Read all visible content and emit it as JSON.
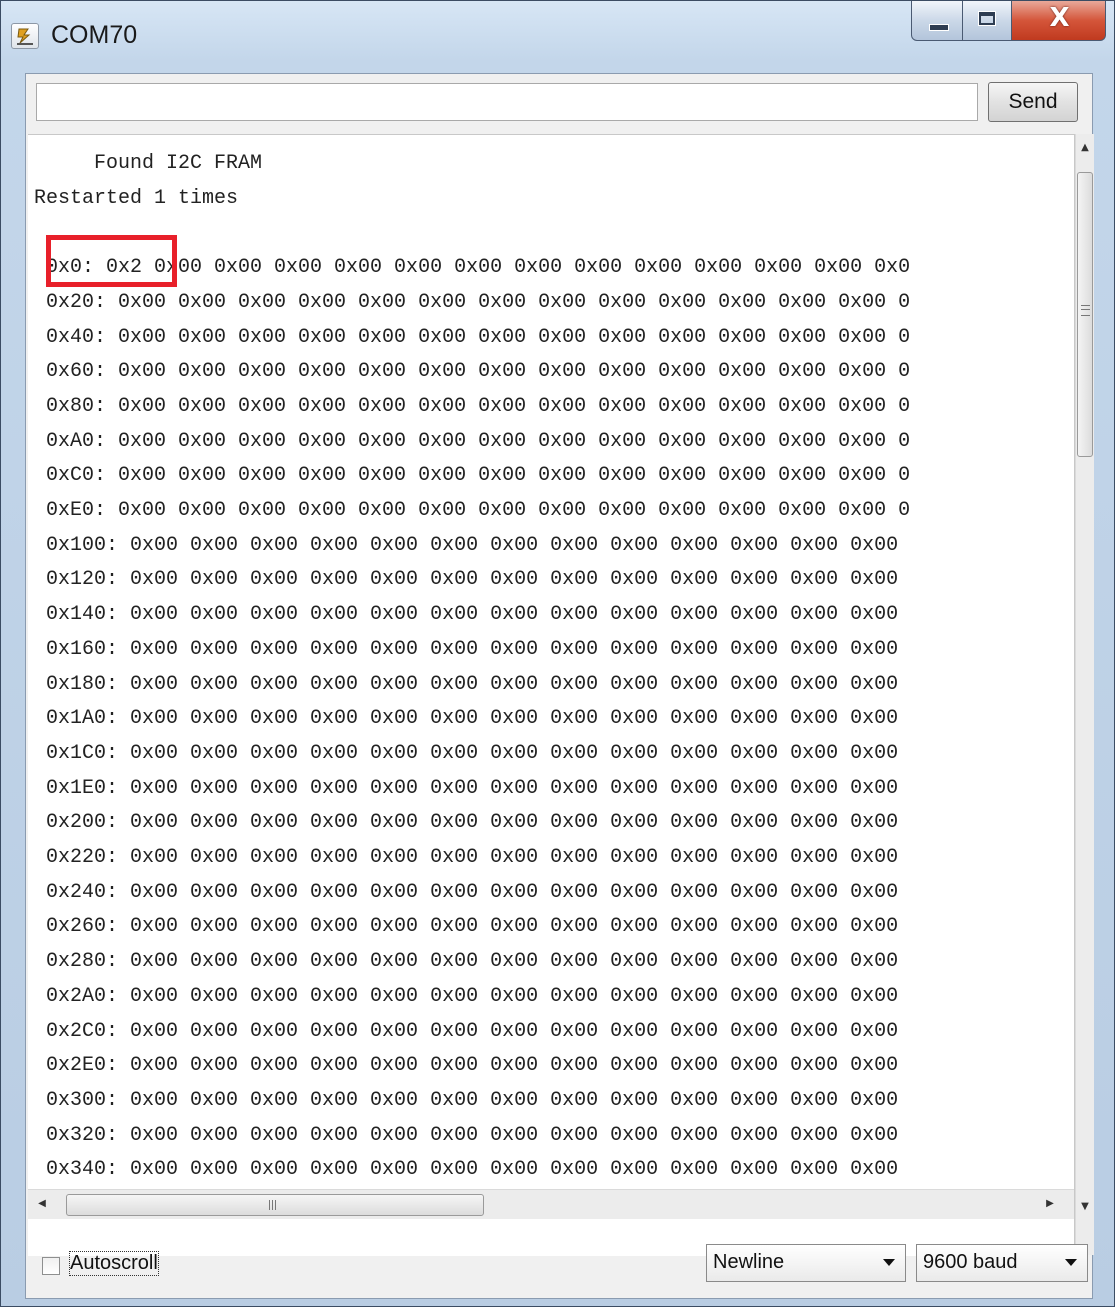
{
  "window": {
    "title": "COM70",
    "app_icon": "serial-monitor-icon",
    "controls": [
      "minimize",
      "maximize",
      "close"
    ],
    "close_glyph": "X"
  },
  "input": {
    "value": "",
    "send_label": "Send"
  },
  "log": {
    "lines": [
      "     Found I2C FRAM",
      "Restarted 1 times",
      "",
      " 0x0: 0x2 0x00 0x00 0x00 0x00 0x00 0x00 0x00 0x00 0x00 0x00 0x00 0x00 0x0",
      " 0x20: 0x00 0x00 0x00 0x00 0x00 0x00 0x00 0x00 0x00 0x00 0x00 0x00 0x00 0",
      " 0x40: 0x00 0x00 0x00 0x00 0x00 0x00 0x00 0x00 0x00 0x00 0x00 0x00 0x00 0",
      " 0x60: 0x00 0x00 0x00 0x00 0x00 0x00 0x00 0x00 0x00 0x00 0x00 0x00 0x00 0",
      " 0x80: 0x00 0x00 0x00 0x00 0x00 0x00 0x00 0x00 0x00 0x00 0x00 0x00 0x00 0",
      " 0xA0: 0x00 0x00 0x00 0x00 0x00 0x00 0x00 0x00 0x00 0x00 0x00 0x00 0x00 0",
      " 0xC0: 0x00 0x00 0x00 0x00 0x00 0x00 0x00 0x00 0x00 0x00 0x00 0x00 0x00 0",
      " 0xE0: 0x00 0x00 0x00 0x00 0x00 0x00 0x00 0x00 0x00 0x00 0x00 0x00 0x00 0",
      " 0x100: 0x00 0x00 0x00 0x00 0x00 0x00 0x00 0x00 0x00 0x00 0x00 0x00 0x00",
      " 0x120: 0x00 0x00 0x00 0x00 0x00 0x00 0x00 0x00 0x00 0x00 0x00 0x00 0x00",
      " 0x140: 0x00 0x00 0x00 0x00 0x00 0x00 0x00 0x00 0x00 0x00 0x00 0x00 0x00",
      " 0x160: 0x00 0x00 0x00 0x00 0x00 0x00 0x00 0x00 0x00 0x00 0x00 0x00 0x00",
      " 0x180: 0x00 0x00 0x00 0x00 0x00 0x00 0x00 0x00 0x00 0x00 0x00 0x00 0x00",
      " 0x1A0: 0x00 0x00 0x00 0x00 0x00 0x00 0x00 0x00 0x00 0x00 0x00 0x00 0x00",
      " 0x1C0: 0x00 0x00 0x00 0x00 0x00 0x00 0x00 0x00 0x00 0x00 0x00 0x00 0x00",
      " 0x1E0: 0x00 0x00 0x00 0x00 0x00 0x00 0x00 0x00 0x00 0x00 0x00 0x00 0x00",
      " 0x200: 0x00 0x00 0x00 0x00 0x00 0x00 0x00 0x00 0x00 0x00 0x00 0x00 0x00",
      " 0x220: 0x00 0x00 0x00 0x00 0x00 0x00 0x00 0x00 0x00 0x00 0x00 0x00 0x00",
      " 0x240: 0x00 0x00 0x00 0x00 0x00 0x00 0x00 0x00 0x00 0x00 0x00 0x00 0x00",
      " 0x260: 0x00 0x00 0x00 0x00 0x00 0x00 0x00 0x00 0x00 0x00 0x00 0x00 0x00",
      " 0x280: 0x00 0x00 0x00 0x00 0x00 0x00 0x00 0x00 0x00 0x00 0x00 0x00 0x00",
      " 0x2A0: 0x00 0x00 0x00 0x00 0x00 0x00 0x00 0x00 0x00 0x00 0x00 0x00 0x00",
      " 0x2C0: 0x00 0x00 0x00 0x00 0x00 0x00 0x00 0x00 0x00 0x00 0x00 0x00 0x00",
      " 0x2E0: 0x00 0x00 0x00 0x00 0x00 0x00 0x00 0x00 0x00 0x00 0x00 0x00 0x00",
      " 0x300: 0x00 0x00 0x00 0x00 0x00 0x00 0x00 0x00 0x00 0x00 0x00 0x00 0x00",
      " 0x320: 0x00 0x00 0x00 0x00 0x00 0x00 0x00 0x00 0x00 0x00 0x00 0x00 0x00",
      " 0x340: 0x00 0x00 0x00 0x00 0x00 0x00 0x00 0x00 0x00 0x00 0x00 0x00 0x00"
    ],
    "highlight_color": "#e8202a"
  },
  "footer": {
    "autoscroll_label": "Autoscroll",
    "autoscroll_checked": false,
    "line_ending": "Newline",
    "baud": "9600 baud"
  },
  "colors": {
    "frame": "#c3d6ea",
    "close_button": "#d4553a",
    "log_bg": "#ffffff"
  }
}
